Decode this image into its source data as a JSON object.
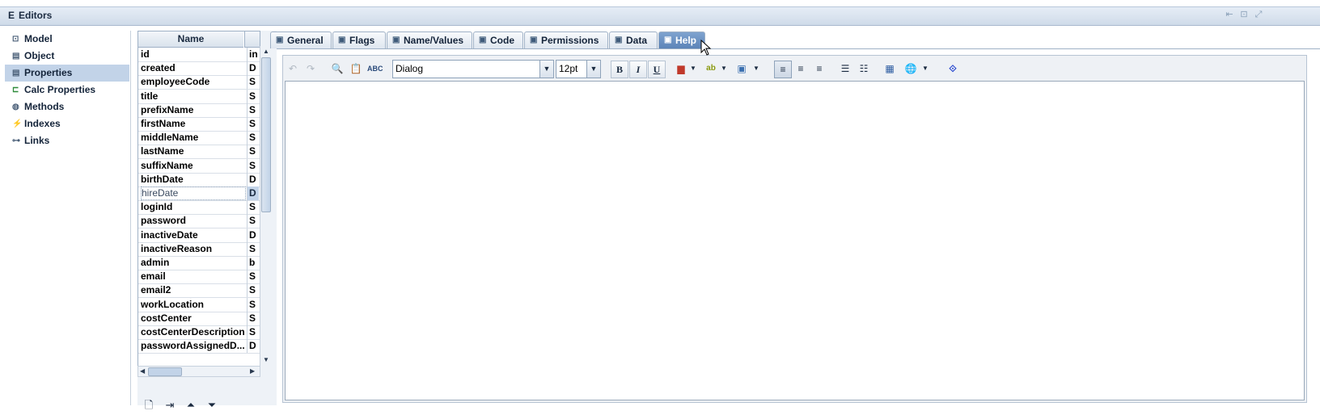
{
  "window": {
    "title": "Editors",
    "title_icon": "E"
  },
  "sidebar": {
    "items": [
      {
        "label": "Model",
        "icon": "model-icon",
        "glyph": "⊡"
      },
      {
        "label": "Object",
        "icon": "object-icon",
        "glyph": "▤"
      },
      {
        "label": "Properties",
        "icon": "properties-icon",
        "glyph": "▤",
        "selected": true
      },
      {
        "label": "Calc Properties",
        "icon": "calc-properties-icon",
        "glyph": "⊏"
      },
      {
        "label": "Methods",
        "icon": "methods-icon",
        "glyph": "◍"
      },
      {
        "label": "Indexes",
        "icon": "indexes-icon",
        "glyph": "⚡"
      },
      {
        "label": "Links",
        "icon": "links-icon",
        "glyph": "⊶"
      }
    ]
  },
  "properties_table": {
    "header": "Name",
    "rows": [
      {
        "name": "id",
        "type": "in"
      },
      {
        "name": "created",
        "type": "D"
      },
      {
        "name": "employeeCode",
        "type": "S"
      },
      {
        "name": "title",
        "type": "S"
      },
      {
        "name": "prefixName",
        "type": "S"
      },
      {
        "name": "firstName",
        "type": "S"
      },
      {
        "name": "middleName",
        "type": "S"
      },
      {
        "name": "lastName",
        "type": "S"
      },
      {
        "name": "suffixName",
        "type": "S"
      },
      {
        "name": "birthDate",
        "type": "D"
      },
      {
        "name": "hireDate",
        "type": "D",
        "selected": true
      },
      {
        "name": "loginId",
        "type": "S"
      },
      {
        "name": "password",
        "type": "S"
      },
      {
        "name": "inactiveDate",
        "type": "D"
      },
      {
        "name": "inactiveReason",
        "type": "S"
      },
      {
        "name": "admin",
        "type": "b"
      },
      {
        "name": "email",
        "type": "S"
      },
      {
        "name": "email2",
        "type": "S"
      },
      {
        "name": "workLocation",
        "type": "S"
      },
      {
        "name": "costCenter",
        "type": "S"
      },
      {
        "name": "costCenterDescription",
        "type": "S"
      },
      {
        "name": "passwordAssignedD...",
        "type": "D"
      }
    ]
  },
  "tabs": [
    {
      "label": "General"
    },
    {
      "label": "Flags"
    },
    {
      "label": "Name/Values"
    },
    {
      "label": "Code"
    },
    {
      "label": "Permissions"
    },
    {
      "label": "Data"
    },
    {
      "label": "Help",
      "active": true
    }
  ],
  "editor_toolbar": {
    "font_family": "Dialog",
    "font_size": "12pt",
    "bold_label": "B",
    "italic_label": "I",
    "underline_label": "U"
  },
  "colors": {
    "selection": "#c2d3e8",
    "active_tab": "#5c84b8",
    "titlebar": "#cfdbe9"
  }
}
